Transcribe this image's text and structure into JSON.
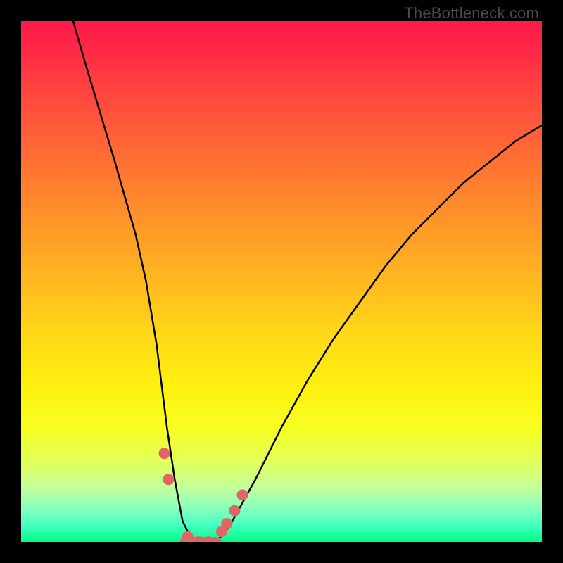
{
  "watermark": "TheBottleneck.com",
  "chart_data": {
    "type": "line",
    "title": "",
    "xlabel": "",
    "ylabel": "",
    "xlim": [
      0,
      100
    ],
    "ylim": [
      0,
      100
    ],
    "series": [
      {
        "name": "bottleneck-curve",
        "x": [
          10,
          12,
          15,
          18,
          20,
          22,
          24,
          25,
          26,
          27,
          28,
          29.5,
          31,
          33,
          35,
          37.5,
          40,
          45,
          50,
          55,
          60,
          65,
          70,
          75,
          80,
          85,
          90,
          95,
          100
        ],
        "values": [
          100,
          93,
          83,
          73,
          66,
          59,
          50,
          44,
          38,
          30,
          22,
          12,
          4,
          0,
          0,
          0,
          3,
          12,
          22,
          31,
          39,
          46,
          53,
          59,
          64,
          69,
          73,
          77,
          80
        ]
      }
    ],
    "markers": {
      "color": "#e06666",
      "radius_px": 8,
      "points": [
        {
          "x": 27.5,
          "y": 17
        },
        {
          "x": 28.3,
          "y": 12
        },
        {
          "x": 32.0,
          "y": 1
        },
        {
          "x": 34.0,
          "y": 0
        },
        {
          "x": 36.0,
          "y": 0
        },
        {
          "x": 38.5,
          "y": 2
        },
        {
          "x": 39.5,
          "y": 3.5
        },
        {
          "x": 41.0,
          "y": 6
        },
        {
          "x": 42.5,
          "y": 9
        }
      ]
    },
    "line_band": {
      "color": "#e06666",
      "y": 0,
      "x_start": 31.5,
      "x_end": 37.5,
      "thickness_px": 14
    }
  }
}
